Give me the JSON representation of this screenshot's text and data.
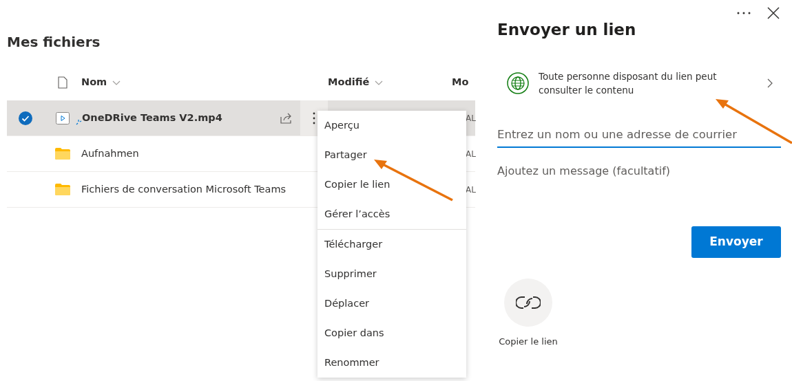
{
  "title": "Mes fichiers",
  "table": {
    "columns": [
      {
        "label": "Nom",
        "sort_caret": true
      },
      {
        "label": "Modifié",
        "sort_caret": true
      },
      {
        "label": "Mo",
        "sort_caret": false
      }
    ],
    "rows": [
      {
        "kind": "video",
        "name": "OneDRive Teams V2.mp4",
        "selected": true,
        "modified": "AL"
      },
      {
        "kind": "folder",
        "name": "Aufnahmen",
        "selected": false,
        "modified": "AL"
      },
      {
        "kind": "folder",
        "name": "Fichiers de conversation Microsoft Teams",
        "selected": false,
        "modified": "AL"
      }
    ]
  },
  "context_menu": {
    "groups": [
      [
        "Aperçu",
        "Partager",
        "Copier le lien",
        "Gérer l’accès"
      ],
      [
        "Télécharger",
        "Supprimer",
        "Déplacer",
        "Copier dans",
        "Renommer"
      ]
    ]
  },
  "panel": {
    "title": "Envoyer un lien",
    "link_setting": "Toute personne disposant du lien peut consulter le contenu",
    "recipient_placeholder": "Entrez un nom ou une adresse de courrier",
    "message_placeholder": "Ajoutez un message (facultatif)",
    "send_button": "Envoyer",
    "copy_link_label": "Copier le lien"
  }
}
